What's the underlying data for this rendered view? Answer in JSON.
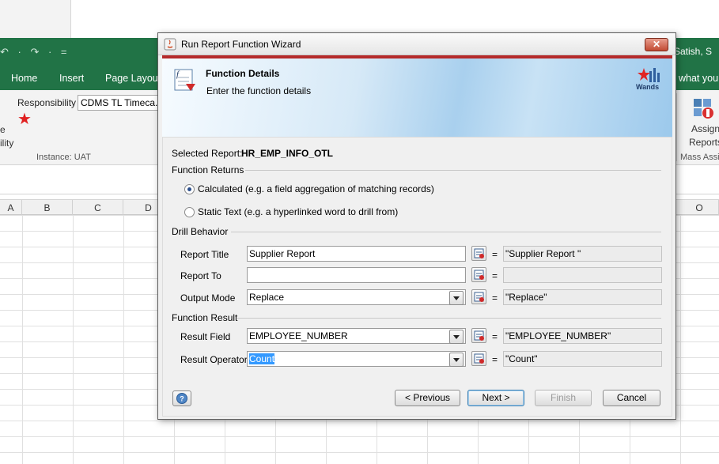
{
  "excel": {
    "quick_access": "↶ · ↷ · =",
    "user": "Satish, S",
    "tabs": [
      "Home",
      "Insert",
      "Page Layout"
    ],
    "tell_me": "what you",
    "ribbon": {
      "responsibility_label": "Responsibility",
      "responsibility_value": "CDMS TL Timeca...",
      "fragment_1": "e",
      "fragment_2": "ility",
      "instance": "Instance: UAT",
      "assign_l1": "Assign",
      "assign_l2": "Reports",
      "mass": "Mass Assi"
    },
    "columns": [
      "A",
      "B",
      "C",
      "D",
      "O"
    ]
  },
  "dialog": {
    "title": "Run Report Function Wizard",
    "close_glyph": "✕",
    "banner_title": "Function Details",
    "banner_subtitle": "Enter the function details",
    "brand": "Wands",
    "selected_report_label": "Selected Report:",
    "selected_report_value": "HR_EMP_INFO_OTL",
    "function_returns_label": "Function Returns",
    "radio_calculated": "Calculated (e.g. a field aggregation of matching records)",
    "radio_static": "Static Text (e.g. a hyperlinked word to drill from)",
    "radio_selected": "calculated",
    "drill_behavior_label": "Drill Behavior",
    "report_title_label": "Report Title",
    "report_title_value": "Supplier Report",
    "report_title_result": "\"Supplier Report \"",
    "report_to_label": "Report To",
    "report_to_value": "",
    "report_to_result": "",
    "output_mode_label": "Output Mode",
    "output_mode_value": "Replace",
    "output_mode_result": "\"Replace\"",
    "function_result_label": "Function Result",
    "result_field_label": "Result Field",
    "result_field_value": "EMPLOYEE_NUMBER",
    "result_field_result": "\"EMPLOYEE_NUMBER\"",
    "result_operator_label": "Result Operator",
    "result_operator_value": "Count",
    "result_operator_result": "\"Count\"",
    "equals": "=",
    "previous_button": "< Previous",
    "next_button": "Next >",
    "finish_button": "Finish",
    "cancel_button": "Cancel"
  },
  "colors": {
    "excel_green": "#217346",
    "banner_red": "#b52a2a",
    "selection_blue": "#3399ff"
  }
}
